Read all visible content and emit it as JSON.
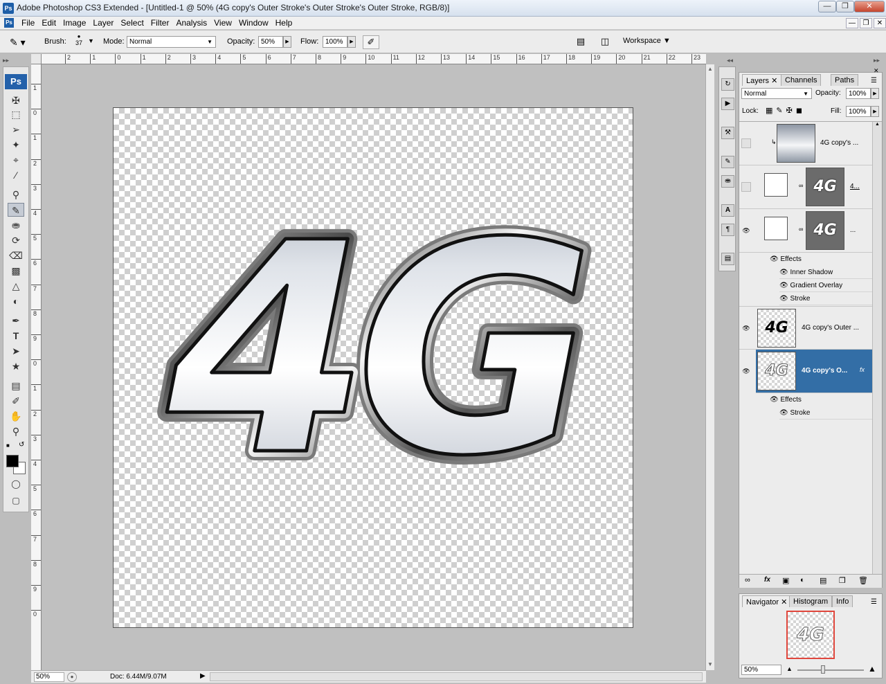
{
  "window": {
    "title": "Adobe Photoshop CS3 Extended - [Untitled-1 @ 50% (4G copy's Outer Stroke's Outer Stroke's Outer Stroke, RGB/8)]",
    "app_icon": "Ps"
  },
  "menu": [
    "File",
    "Edit",
    "Image",
    "Layer",
    "Select",
    "Filter",
    "Analysis",
    "View",
    "Window",
    "Help"
  ],
  "options_bar": {
    "brush_label": "Brush:",
    "brush_size": "37",
    "mode_label": "Mode:",
    "mode_value": "Normal",
    "opacity_label": "Opacity:",
    "opacity_value": "50%",
    "flow_label": "Flow:",
    "flow_value": "100%",
    "workspace_label": "Workspace"
  },
  "toolbox": {
    "logo": "Ps"
  },
  "ruler": {
    "top_ticks": [
      "2",
      "1",
      "0",
      "1",
      "2",
      "3",
      "4",
      "5",
      "6",
      "7",
      "8",
      "9",
      "10",
      "11",
      "12",
      "13",
      "14",
      "15",
      "16",
      "17",
      "18",
      "19",
      "20",
      "21",
      "22",
      "23"
    ],
    "left_ticks": [
      "1",
      "0",
      "1",
      "2",
      "3",
      "4",
      "5",
      "6",
      "7",
      "8",
      "9",
      "0",
      "1",
      "2",
      "3",
      "4",
      "5",
      "6",
      "7",
      "8",
      "9",
      "0"
    ]
  },
  "canvas": {
    "artwork_text": "4G"
  },
  "status": {
    "zoom": "50%",
    "doc": "Doc: 6.44M/9.07M"
  },
  "layers_panel": {
    "tabs": [
      "Layers",
      "Channels",
      "Paths"
    ],
    "blend_mode": "Normal",
    "opacity_label": "Opacity:",
    "opacity_value": "100%",
    "lock_label": "Lock:",
    "fill_label": "Fill:",
    "fill_value": "100%",
    "layers": [
      {
        "name": "4G copy's ...",
        "thumb": ""
      },
      {
        "name": "4...",
        "thumb": "4G"
      },
      {
        "name": "...",
        "thumb": "4G"
      },
      {
        "name": "4G copy's Outer ...",
        "thumb": "4G"
      },
      {
        "name": "4G copy's O...",
        "thumb": "4G"
      }
    ],
    "effects_label": "Effects",
    "effects_group1": [
      "Inner Shadow",
      "Gradient Overlay",
      "Stroke"
    ],
    "effects_group2": [
      "Stroke"
    ]
  },
  "navigator_panel": {
    "tabs": [
      "Navigator",
      "Histogram",
      "Info"
    ],
    "zoom": "50%",
    "thumb_text": "4G"
  },
  "colors": {
    "selection": "#336ea6",
    "accent": "#2461aa"
  }
}
